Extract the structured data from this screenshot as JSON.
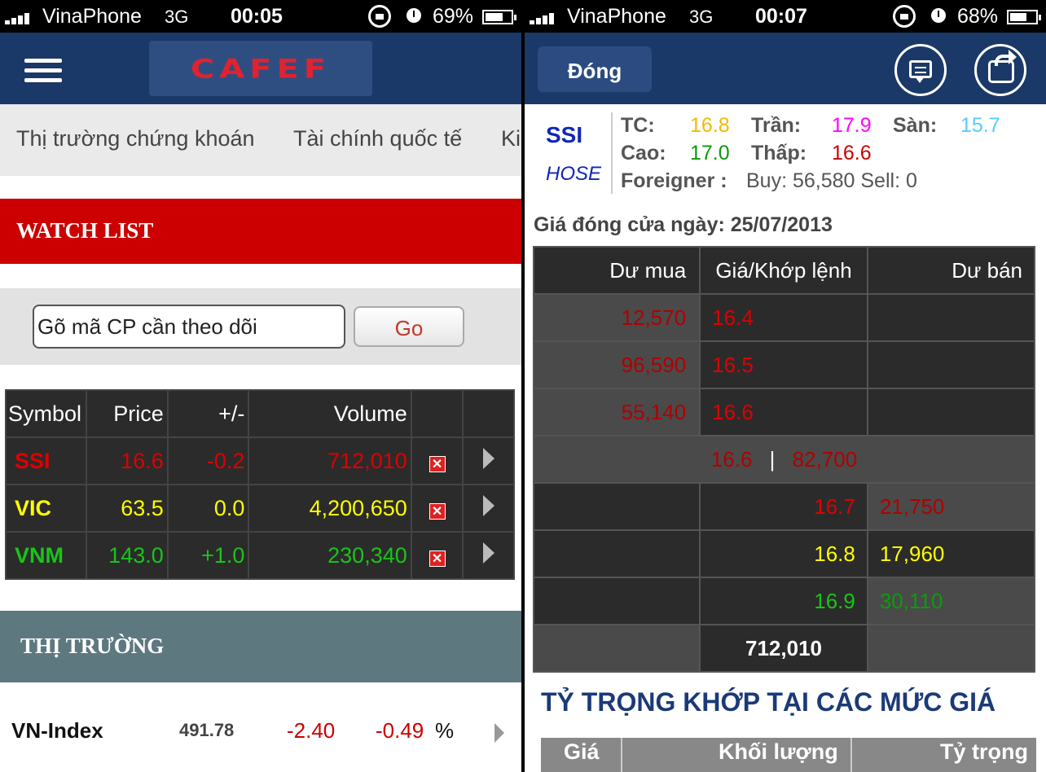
{
  "left": {
    "status": {
      "carrier": "VinaPhone",
      "network": "3G",
      "time": "00:05",
      "battery": "69%",
      "battery_level": 0.69
    },
    "header": {
      "logo": "CAFEF"
    },
    "tabs": [
      "Thị trường chứng khoán",
      "Tài chính quốc tế",
      "Ki"
    ],
    "watchlist": {
      "title": "WATCH LIST",
      "search_placeholder": "Gõ mã CP cần theo dõi",
      "go_label": "Go",
      "columns": [
        "Symbol",
        "Price",
        "+/-",
        "Volume"
      ],
      "rows": [
        {
          "symbol": "SSI",
          "price": "16.6",
          "change": "-0.2",
          "volume": "712,010",
          "color": "#dd0000"
        },
        {
          "symbol": "VIC",
          "price": "63.5",
          "change": "0.0",
          "volume": "4,200,650",
          "color": "#ffff00"
        },
        {
          "symbol": "VNM",
          "price": "143.0",
          "change": "+1.0",
          "volume": "230,340",
          "color": "#19c419"
        }
      ]
    },
    "market": {
      "title": "THỊ TRƯỜNG",
      "index": {
        "name": "VN-Index",
        "value": "491.78",
        "change": "-2.40",
        "percent": "-0.49",
        "percent_sign": "%"
      }
    }
  },
  "right": {
    "status": {
      "carrier": "VinaPhone",
      "network": "3G",
      "time": "00:07",
      "battery": "68%",
      "battery_level": 0.68
    },
    "header": {
      "close_label": "Đóng"
    },
    "stock": {
      "symbol": "SSI",
      "exchange": "HOSE",
      "tc_label": "TC:",
      "tc": "16.8",
      "tran_label": "Trần:",
      "tran": "17.9",
      "san_label": "Sàn:",
      "san": "15.7",
      "cao_label": "Cao:",
      "cao": "17.0",
      "thap_label": "Thấp:",
      "thap": "16.6",
      "foreigner_label": "Foreigner :",
      "foreigner_value": "Buy: 56,580 Sell: 0"
    },
    "closing_label": "Giá đóng cửa ngày: 25/07/2013",
    "orderbook": {
      "headers": [
        "Dư mua",
        "Giá/Khớp lệnh",
        "Dư bán"
      ],
      "bids": [
        {
          "volume": "12,570",
          "price": "16.4"
        },
        {
          "volume": "96,590",
          "price": "16.5"
        },
        {
          "volume": "55,140",
          "price": "16.6"
        }
      ],
      "match": {
        "price": "16.6",
        "separator": "|",
        "volume": "82,700"
      },
      "asks": [
        {
          "price": "16.7",
          "volume": "21,750"
        },
        {
          "price": "16.8",
          "volume": "17,960"
        },
        {
          "price": "16.9",
          "volume": "30,110"
        }
      ],
      "total": "712,010"
    },
    "weights": {
      "title": "TỶ TRỌNG KHỚP TẠI CÁC MỨC GIÁ",
      "columns": [
        "Giá",
        "Khối lượng",
        "Tỷ trọng"
      ]
    }
  },
  "colors": {
    "header_bg": "#1b3968",
    "watch_red": "#cc0000",
    "market_gray": "#5e7880",
    "up": "#19c419",
    "down": "#dd0000",
    "ref": "#ffff00",
    "ceiling": "#ff00ff",
    "floor": "#55ccff"
  }
}
